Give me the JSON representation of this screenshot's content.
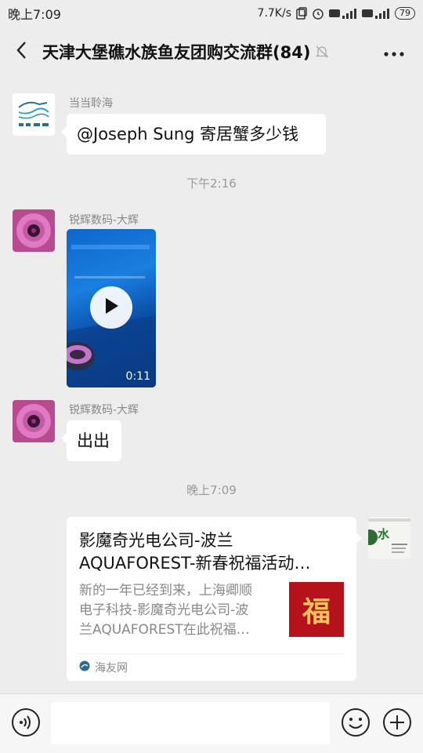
{
  "status_bar": {
    "time": "晚上7:09",
    "net_speed": "7.7K/s",
    "battery": "79"
  },
  "header": {
    "title": "天津大堡礁水族鱼友团购交流群(84)"
  },
  "messages": [
    {
      "nickname": "当当聆海",
      "text": "@Joseph Sung  寄居蟹多少钱"
    },
    {
      "time": "下午2:16"
    },
    {
      "nickname": "锐辉数码-大辉",
      "video_duration": "0:11"
    },
    {
      "nickname": "锐辉数码-大辉",
      "text": "出出"
    },
    {
      "time": "晚上7:09"
    }
  ],
  "share_card": {
    "title_line1": "影魔奇光电公司-波兰",
    "title_line2": "AQUAFOREST-新春祝福活动…",
    "desc_line1": "新的一年已经到来，上海卿顺",
    "desc_line2": "电子科技-影魔奇光电公司-波",
    "desc_line3": "兰AQUAFOREST在此祝福…",
    "thumb_char": "福",
    "source": "海友网"
  },
  "self_avatar_char": "水",
  "colors": {
    "background": "#ededed",
    "bubble": "#ffffff",
    "video_blue": "#1a7fe0",
    "thumb_red": "#b5121b"
  },
  "icons": [
    "back-arrow-icon",
    "mute-bell-icon",
    "more-dots-icon",
    "play-icon",
    "voice-icon",
    "emoji-icon",
    "plus-icon",
    "source-logo-icon"
  ]
}
